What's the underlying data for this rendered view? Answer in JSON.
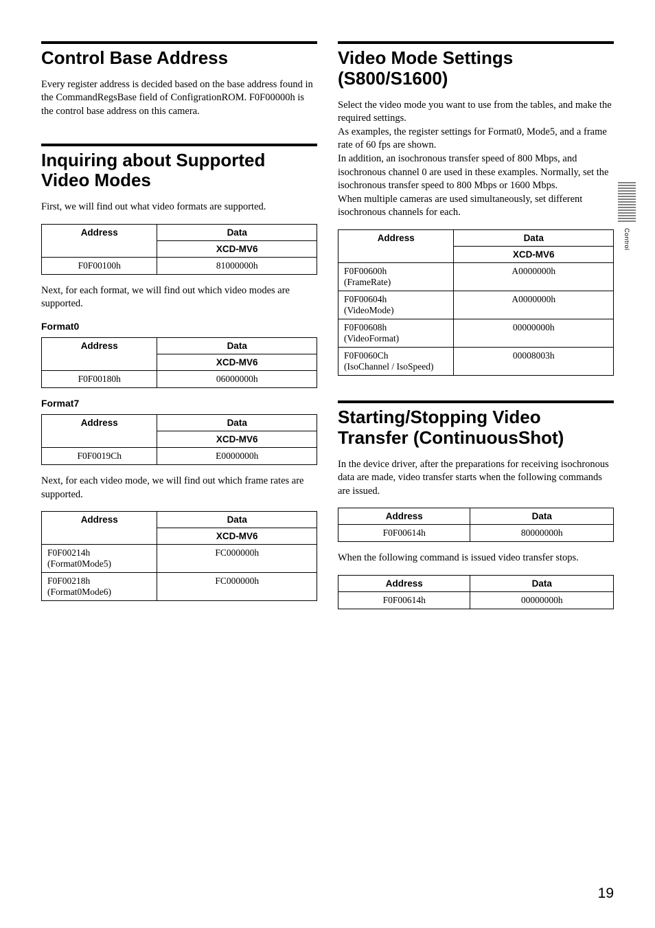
{
  "pageNumber": "19",
  "sideTab": {
    "label": "Control"
  },
  "left": {
    "s1": {
      "title": "Control Base Address",
      "para": "Every register address is decided based on the base address found in the CommandRegsBase field of ConfigrationROM. F0F00000h is the control base address on this camera."
    },
    "s2": {
      "title": "Inquiring about Supported Video Modes",
      "para1": "First, we will find out what video formats are supported.",
      "table1": {
        "hAddr": "Address",
        "hData": "Data",
        "hSub": "XCD-MV6",
        "r1a": "F0F00100h",
        "r1d": "81000000h"
      },
      "para2": "Next, for each format, we will find out which video modes are supported.",
      "fmt0": "Format0",
      "table2": {
        "hAddr": "Address",
        "hData": "Data",
        "hSub": "XCD-MV6",
        "r1a": "F0F00180h",
        "r1d": "06000000h"
      },
      "fmt7": "Format7",
      "table3": {
        "hAddr": "Address",
        "hData": "Data",
        "hSub": "XCD-MV6",
        "r1a": "F0F0019Ch",
        "r1d": "E0000000h"
      },
      "para3": "Next, for each video mode, we will find out which frame rates are supported.",
      "table4": {
        "hAddr": "Address",
        "hData": "Data",
        "hSub": "XCD-MV6",
        "r1a": "F0F00214h",
        "r1n": "(Format0Mode5)",
        "r1d": "FC000000h",
        "r2a": "F0F00218h",
        "r2n": "(Format0Mode6)",
        "r2d": "FC000000h"
      }
    }
  },
  "right": {
    "s3": {
      "title": "Video Mode Settings (S800/S1600)",
      "para": "Select the video mode you want to use from the tables, and make the required settings.\nAs examples, the register settings for Format0, Mode5, and a frame rate of 60 fps are shown.\nIn addition, an isochronous transfer speed of 800 Mbps, and isochronous channel 0 are used in these examples. Normally, set the isochronous transfer speed to 800 Mbps or 1600 Mbps.\nWhen multiple cameras are used simultaneously, set different isochronous channels for each.",
      "table": {
        "hAddr": "Address",
        "hData": "Data",
        "hSub": "XCD-MV6",
        "r1a": "F0F00600h",
        "r1n": "(FrameRate)",
        "r1d": "A0000000h",
        "r2a": "F0F00604h",
        "r2n": "(VideoMode)",
        "r2d": "A0000000h",
        "r3a": "F0F00608h",
        "r3n": "(VideoFormat)",
        "r3d": "00000000h",
        "r4a": "F0F0060Ch",
        "r4n": "(IsoChannel / IsoSpeed)",
        "r4d": "00008003h"
      }
    },
    "s4": {
      "title": "Starting/Stopping Video Transfer (ContinuousShot)",
      "para1": "In the device driver, after the preparations for receiving isochronous data are made, video transfer starts when the following commands are issued.",
      "table1": {
        "hAddr": "Address",
        "hData": "Data",
        "r1a": "F0F00614h",
        "r1d": "80000000h"
      },
      "para2": "When the following command is issued video transfer stops.",
      "table2": {
        "hAddr": "Address",
        "hData": "Data",
        "r1a": "F0F00614h",
        "r1d": "00000000h"
      }
    }
  }
}
